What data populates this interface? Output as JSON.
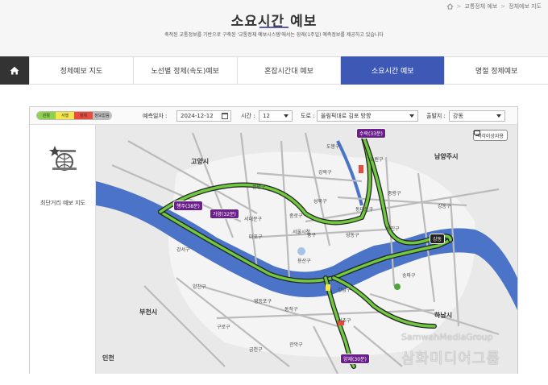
{
  "header": {
    "breadcrumb": [
      "교통정체 예보",
      "정체예보 지도"
    ],
    "title": "소요시간 예보",
    "subtitle": "축적된 교통정보를 기반으로 구축된 '교통정체 예보시스템'에서는 장래(1주일) 예측정보를 제공하고 있습니다"
  },
  "tabs": [
    {
      "label": "정체예보 지도",
      "active": false
    },
    {
      "label": "노선별 정체(속도)예보",
      "active": false
    },
    {
      "label": "혼잡시간대 예보",
      "active": false
    },
    {
      "label": "소요시간 예보",
      "active": true
    },
    {
      "label": "명절 정체예보",
      "active": false
    }
  ],
  "legend": [
    {
      "label": "원활",
      "color": "#8dd24a"
    },
    {
      "label": "서행",
      "color": "#f5e64a"
    },
    {
      "label": "정체",
      "color": "#e94b3c"
    },
    {
      "label": "정보없음",
      "color": "#bdbdbd"
    }
  ],
  "toolbar": {
    "date_label": "예측일자 :",
    "date_value": "2024-12-12",
    "time_label": "시간 :",
    "time_value": "12",
    "road_label": "도로 :",
    "road_value": "올림픽대로 김포 방향",
    "origin_label": "출발지 :",
    "origin_value": "강동"
  },
  "side": {
    "label": "최단거리 예보 지도",
    "icon": "shortest-route-icon"
  },
  "map": {
    "color_button": "색각이상자용",
    "tags": [
      {
        "label": "수락(33분)",
        "kind": "purple"
      },
      {
        "label": "행주(38분)",
        "kind": "purple"
      },
      {
        "label": "가양(32분)",
        "kind": "purple"
      },
      {
        "label": "강동",
        "kind": "black"
      },
      {
        "label": "양재(30분)",
        "kind": "purple"
      }
    ],
    "cities": [
      "고양시",
      "남양주시",
      "부천시",
      "하남시",
      "인천"
    ],
    "districts": [
      "은평구",
      "강북구",
      "도봉구",
      "노원구",
      "중랑구",
      "성북구",
      "종로구",
      "서대문구",
      "마포구",
      "중구",
      "용산구",
      "성동구",
      "광진구",
      "동대문구",
      "강서구",
      "양천구",
      "영등포구",
      "동작구",
      "관악구",
      "서초구",
      "강남구",
      "송파구",
      "강동구",
      "구로구",
      "금천구",
      "서울시청"
    ]
  },
  "watermark": {
    "en": "SamwahMediaGroup",
    "ko": "삼화미디어그룹"
  }
}
